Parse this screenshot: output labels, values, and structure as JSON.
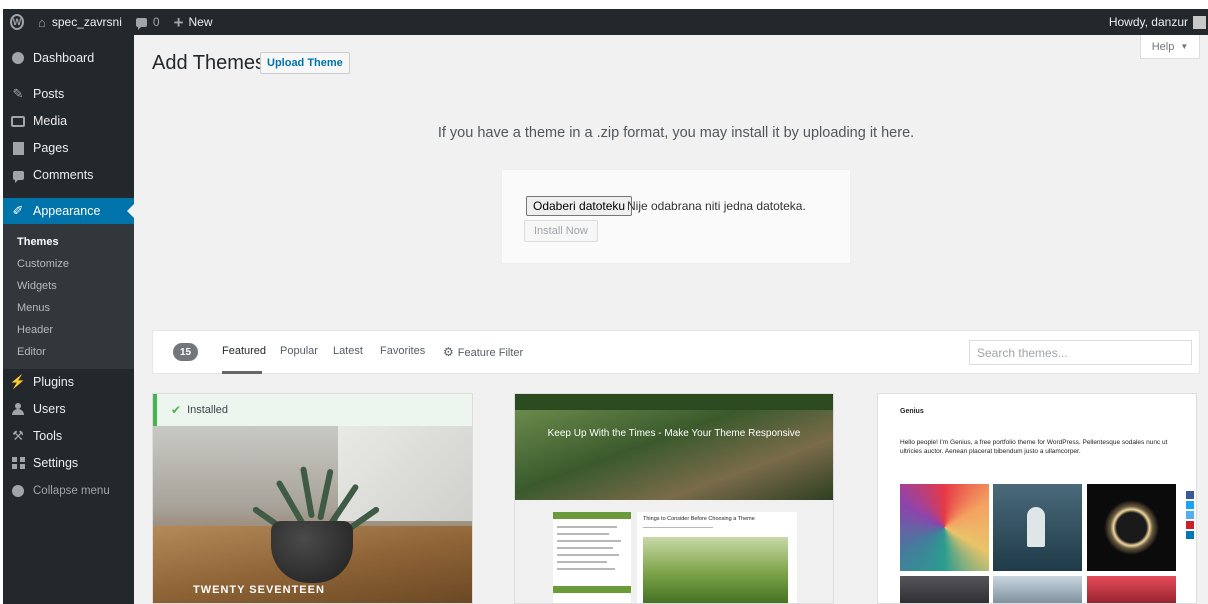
{
  "adminbar": {
    "site_name": "spec_zavrsni",
    "comments_count": "0",
    "new_label": "New",
    "howdy": "Howdy, danzur"
  },
  "sidebar": {
    "items": [
      {
        "label": "Dashboard",
        "icon": "dashboard-icon"
      },
      {
        "label": "Posts",
        "icon": "pin-icon"
      },
      {
        "label": "Media",
        "icon": "media-icon"
      },
      {
        "label": "Pages",
        "icon": "pages-icon"
      },
      {
        "label": "Comments",
        "icon": "comment-icon"
      },
      {
        "label": "Appearance",
        "icon": "paintbrush-icon",
        "active": true
      },
      {
        "label": "Plugins",
        "icon": "plug-icon"
      },
      {
        "label": "Users",
        "icon": "users-icon"
      },
      {
        "label": "Tools",
        "icon": "wrench-icon"
      },
      {
        "label": "Settings",
        "icon": "settings-icon"
      },
      {
        "label": "Collapse menu",
        "icon": "collapse-icon"
      }
    ],
    "submenu": [
      "Themes",
      "Customize",
      "Widgets",
      "Menus",
      "Header",
      "Editor"
    ]
  },
  "main": {
    "title": "Add Themes",
    "upload_button": "Upload Theme",
    "help_label": "Help",
    "upload_message": "If you have a theme in a .zip format, you may install it by uploading it here.",
    "file_button": "Odaberi datoteku",
    "file_status": "Nije odabrana niti jedna datoteka.",
    "install_button": "Install Now"
  },
  "filter": {
    "count": "15",
    "tabs": [
      "Featured",
      "Popular",
      "Latest",
      "Favorites"
    ],
    "feature_filter": "Feature Filter",
    "search_placeholder": "Search themes..."
  },
  "themes": [
    {
      "installed_label": "Installed",
      "screenshot_title": "TWENTY SEVENTEEN"
    },
    {
      "hero_text": "Keep Up With the Times - Make Your Theme Responsive",
      "post_title": "Things to Consider Before Choosing a Theme"
    },
    {
      "logo": "Genius",
      "intro": "Hello people! I'm Genius, a free portfolio theme for WordPress. Pellentesque sodales nunc ut ultricies auctor. Aenean placerat bibendum justo a ullamcorper."
    }
  ],
  "colors": {
    "adminbar_bg": "#23282d",
    "active_menu": "#0073aa",
    "installed_green": "#46b450"
  }
}
